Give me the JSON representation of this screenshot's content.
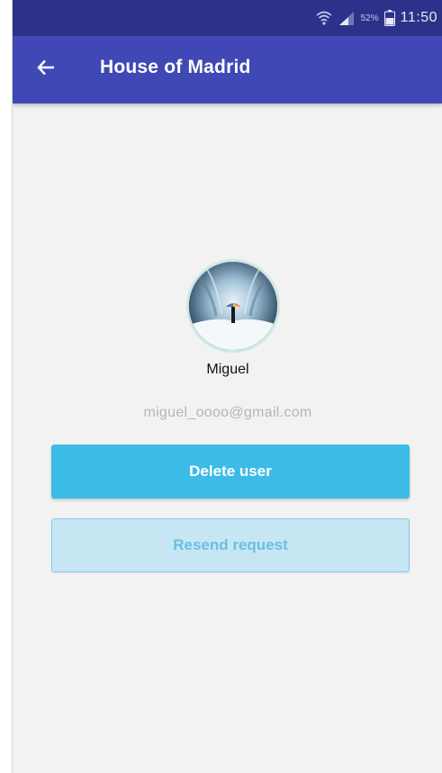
{
  "status_bar": {
    "battery_percent": "52%",
    "time": "11:50",
    "icons": [
      "wifi-icon",
      "signal-icon",
      "battery-icon"
    ]
  },
  "app_bar": {
    "back_icon": "arrow-left-icon",
    "title": "House of Madrid"
  },
  "profile": {
    "name": "Miguel",
    "email": "miguel_oooo@gmail.com"
  },
  "actions": {
    "delete_label": "Delete user",
    "resend_label": "Resend request"
  },
  "colors": {
    "status_bar": "#2c3289",
    "app_bar": "#3f48b5",
    "primary_button": "#3dbbe7",
    "secondary_button": "#c6e6f4",
    "background": "#f2f2f2"
  }
}
